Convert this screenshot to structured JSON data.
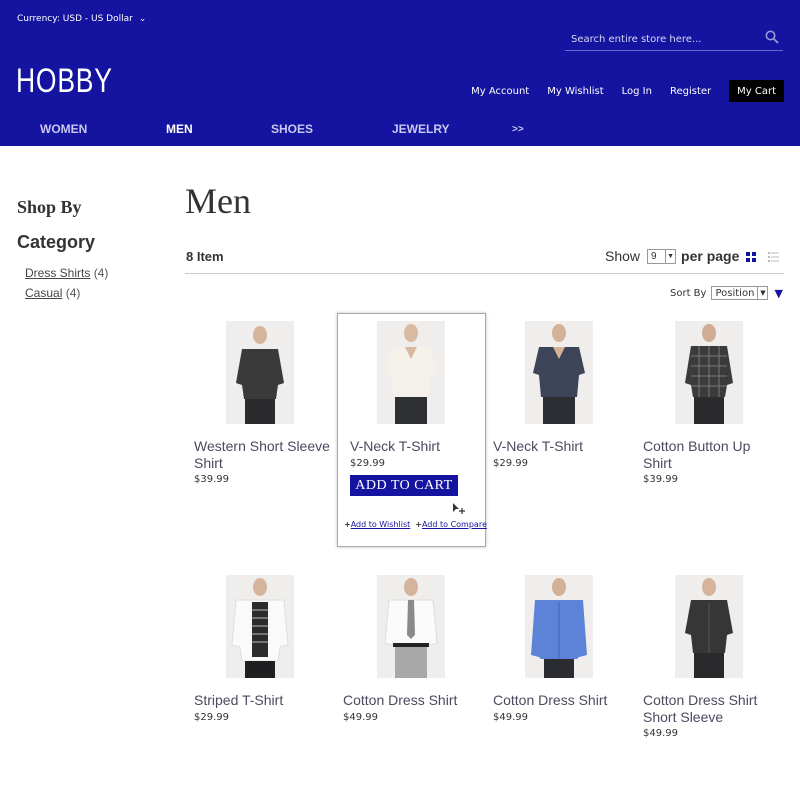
{
  "header": {
    "currency_label": "Currency: USD - US Dollar",
    "search_placeholder": "Search entire store here...",
    "logo": "HOBBY",
    "links": {
      "account": "My Account",
      "wishlist": "My Wishlist",
      "login": "Log In",
      "register": "Register",
      "cart": "My Cart"
    },
    "nav": [
      "WOMEN",
      "MEN",
      "SHOES",
      "JEWELRY",
      ">>"
    ]
  },
  "sidebar": {
    "shop_by": "Shop By",
    "category_title": "Category",
    "categories": [
      {
        "label": "Dress Shirts",
        "count": "(4)"
      },
      {
        "label": "Casual",
        "count": "(4)"
      }
    ]
  },
  "main": {
    "title": "Men",
    "item_count": "8 Item",
    "show_label": "Show",
    "show_value": "9",
    "per_page": "per page",
    "sort_label": "Sort By",
    "sort_value": "Position"
  },
  "products": [
    {
      "name": "Western Short Sleeve Shirt",
      "price": "$39.99"
    },
    {
      "name": "V-Neck T-Shirt",
      "price": "$29.99"
    },
    {
      "name": "V-Neck T-Shirt",
      "price": "$29.99"
    },
    {
      "name": "Cotton Button Up Shirt",
      "price": "$39.99"
    },
    {
      "name": "Striped T-Shirt",
      "price": "$29.99"
    },
    {
      "name": "Cotton Dress Shirt",
      "price": "$49.99"
    },
    {
      "name": "Cotton Dress Shirt",
      "price": "$49.99"
    },
    {
      "name": "Cotton Dress Shirt Short Sleeve",
      "price": "$49.99"
    }
  ],
  "hover_product": {
    "add_to_cart": "ADD TO CART",
    "add_to_wishlist": "Add to Wishlist",
    "add_to_compare": "Add to Compare"
  },
  "colors": {
    "brand": "#1414a0",
    "cart_bg": "#000000"
  }
}
